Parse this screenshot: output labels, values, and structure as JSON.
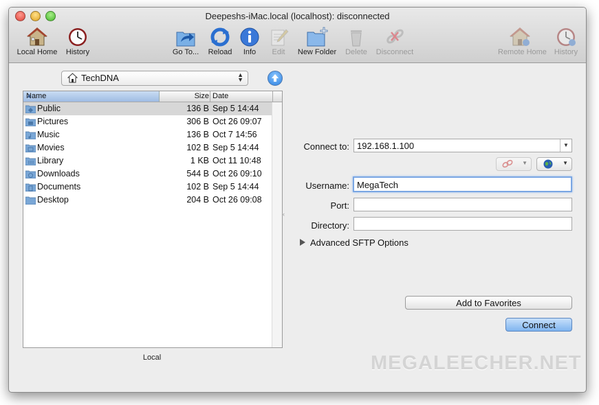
{
  "window": {
    "title": "Deepeshs-iMac.local (localhost): disconnected"
  },
  "toolbar": {
    "local_home": "Local Home",
    "history_left": "History",
    "go_to": "Go To...",
    "reload": "Reload",
    "info": "Info",
    "edit": "Edit",
    "new_folder": "New Folder",
    "delete": "Delete",
    "disconnect": "Disconnect",
    "remote_home": "Remote Home",
    "history_right": "History"
  },
  "local": {
    "path": "TechDNA",
    "label": "Local",
    "columns": {
      "name": "Name",
      "size": "Size",
      "date": "Date"
    },
    "files": [
      {
        "name": "Public",
        "size": "136 B",
        "date": "Sep 5 14:44",
        "icon": "public-folder-icon"
      },
      {
        "name": "Pictures",
        "size": "306 B",
        "date": "Oct 26 09:07",
        "icon": "pictures-folder-icon"
      },
      {
        "name": "Music",
        "size": "136 B",
        "date": "Oct 7 14:56",
        "icon": "music-folder-icon"
      },
      {
        "name": "Movies",
        "size": "102 B",
        "date": "Sep 5 14:44",
        "icon": "movies-folder-icon"
      },
      {
        "name": "Library",
        "size": "1 KB",
        "date": "Oct 11 10:48",
        "icon": "library-folder-icon"
      },
      {
        "name": "Downloads",
        "size": "544 B",
        "date": "Oct 26 09:10",
        "icon": "downloads-folder-icon"
      },
      {
        "name": "Documents",
        "size": "102 B",
        "date": "Sep 5 14:44",
        "icon": "documents-folder-icon"
      },
      {
        "name": "Desktop",
        "size": "204 B",
        "date": "Oct 26 09:08",
        "icon": "desktop-folder-icon"
      }
    ]
  },
  "connect": {
    "connect_to_label": "Connect to:",
    "connect_to_value": "192.168.1.100",
    "username_label": "Username:",
    "username_value": "MegaTech",
    "port_label": "Port:",
    "port_value": "",
    "directory_label": "Directory:",
    "directory_value": "",
    "advanced": "Advanced SFTP Options",
    "add_favorites": "Add to Favorites",
    "connect_button": "Connect"
  },
  "watermark": "MEGALEECHER.NET",
  "colors": {
    "accent": "#7fb4ef",
    "selection": "#d7d7d7",
    "folder": "#7aa7d6"
  }
}
